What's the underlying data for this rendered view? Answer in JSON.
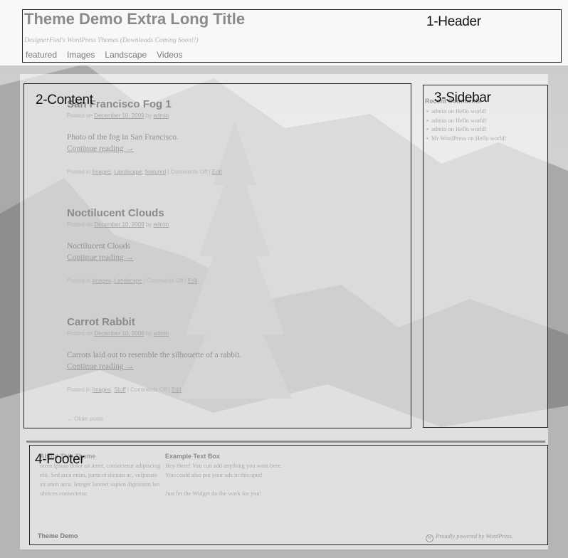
{
  "header": {
    "site_title": "Theme Demo Extra Long Title",
    "tagline": "DesignerFied's WordPress Themes (Downloads Coming Soon!!)",
    "nav": [
      "featured",
      "Images",
      "Landscape",
      "Videos"
    ]
  },
  "posts": [
    {
      "title": "San Francisco Fog 1",
      "meta_prefix": "Posted on",
      "date": "December 10, 2009",
      "meta_by": "by",
      "author": "admin",
      "excerpt": "Photo of the fog in San Francisco.",
      "continue": "Continue reading →",
      "footer_prefix": "Posted in",
      "categories": [
        "Images",
        "Landscape",
        "featured"
      ],
      "comments": "| Comments Off |",
      "edit": "Edit"
    },
    {
      "title": "Noctilucent Clouds",
      "meta_prefix": "Posted on",
      "date": "December 10, 2009",
      "meta_by": "by",
      "author": "admin",
      "excerpt": "Noctilucent Clouds",
      "continue": "Continue reading →",
      "footer_prefix": "Posted in",
      "categories": [
        "Images",
        "Landscape"
      ],
      "comments": "| Comments Off |",
      "edit": "Edit"
    },
    {
      "title": "Carrot Rabbit",
      "meta_prefix": "Posted on",
      "date": "December 10, 2009",
      "meta_by": "by",
      "author": "admin",
      "excerpt": "Carrots laid out to resemble the silhouette of a rabbit.",
      "continue": "Continue reading →",
      "footer_prefix": "Posted in",
      "categories": [
        "Images",
        "Stuff"
      ],
      "comments": "| Comments Off |",
      "edit": "Edit"
    }
  ],
  "older_posts": "← Older posts",
  "sidebar": {
    "heading": "Recent Comments",
    "comments": [
      "admin on Hello world!",
      "admin on Hello world!",
      "admin on Hello world!",
      "Mr WordPress on Hello world!"
    ]
  },
  "footer": {
    "widget1_title": "About This Theme",
    "widget1_text": "orem ipsum dolor sit amet, consectetur adipiscing elit. Sed arcu enim, porta et dictum ac, vulputate sit amet arcu. Integer laoreet sapien dignissim leo ultrices consectetur.",
    "widget2_title": "Example Text Box",
    "widget2_text": "Hey there! You can add anything you want here. You could also put your ads in this spot!",
    "widget2_text_2": "Just let the Widget do the work for you!",
    "site_name": "Theme Demo",
    "wp_icon": "W",
    "powered_by": "Proudly powered by WordPress."
  },
  "annotations": {
    "header": "1-Header",
    "content": "2-Content",
    "sidebar": "3-Sidebar",
    "footer": "4-Footer"
  },
  "colors": {
    "annotation_border": "#222222",
    "page_overlay": "#ffffff",
    "text_muted": "#8a8a8a"
  }
}
